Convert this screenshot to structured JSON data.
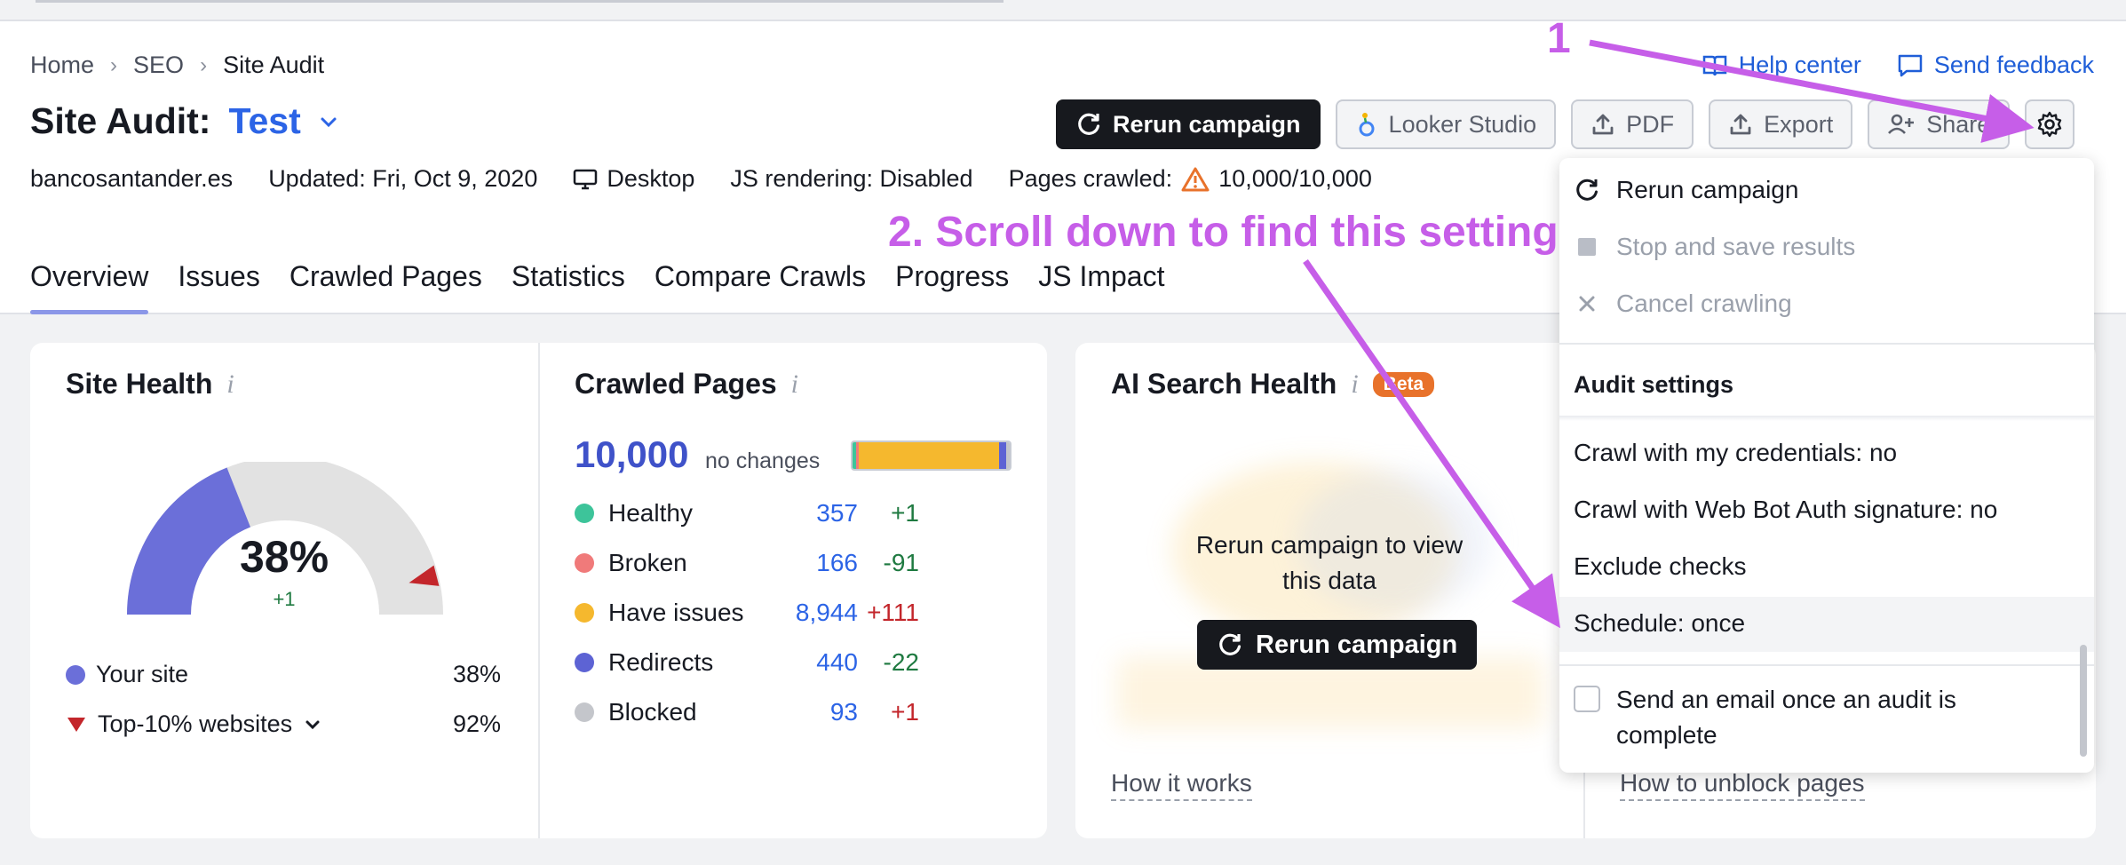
{
  "breadcrumb": [
    "Home",
    "SEO",
    "Site Audit"
  ],
  "title": {
    "label": "Site Audit:",
    "project": "Test"
  },
  "meta": {
    "domain": "bancosantander.es",
    "updated": "Updated: Fri, Oct 9, 2020",
    "device": "Desktop",
    "js_rendering": "JS rendering: Disabled",
    "pages_crawled_label": "Pages crawled:",
    "pages_crawled_value": "10,000/10,000"
  },
  "top_links": {
    "help": "Help center",
    "feedback": "Send feedback"
  },
  "toolbar": {
    "rerun": "Rerun campaign",
    "looker": "Looker Studio",
    "pdf": "PDF",
    "export": "Export",
    "share": "Share"
  },
  "tabs": [
    "Overview",
    "Issues",
    "Crawled Pages",
    "Statistics",
    "Compare Crawls",
    "Progress",
    "JS Impact"
  ],
  "site_health": {
    "title": "Site Health",
    "percent": "38%",
    "delta": "+1",
    "value_fraction": 0.38,
    "top10_fraction": 0.92,
    "legend": [
      {
        "label": "Your site",
        "value": "38%"
      },
      {
        "label": "Top-10% websites",
        "value": "92%"
      }
    ]
  },
  "crawled_pages": {
    "title": "Crawled Pages",
    "total": "10,000",
    "total_note": "no changes",
    "rows": [
      {
        "label": "Healthy",
        "value": "357",
        "delta": "+1",
        "color": "#3dc49a",
        "delta_color": "#1f7a41"
      },
      {
        "label": "Broken",
        "value": "166",
        "delta": "-91",
        "color": "#f07a7a",
        "delta_color": "#1f7a41"
      },
      {
        "label": "Have issues",
        "value": "8,944",
        "delta": "+111",
        "color": "#f5b82e",
        "delta_color": "#c3262b"
      },
      {
        "label": "Redirects",
        "value": "440",
        "delta": "-22",
        "color": "#5d63d4",
        "delta_color": "#1f7a41"
      },
      {
        "label": "Blocked",
        "value": "93",
        "delta": "+1",
        "color": "#c4c6cb",
        "delta_color": "#c3262b"
      }
    ]
  },
  "ai_search": {
    "title": "AI Search Health",
    "badge": "Beta",
    "message": "Rerun campaign to view this data",
    "button": "Rerun campaign",
    "link1": "How it works",
    "link2": "How to unblock pages"
  },
  "menu": {
    "actions": [
      {
        "label": "Rerun campaign",
        "disabled": false
      },
      {
        "label": "Stop and save results",
        "disabled": true
      },
      {
        "label": "Cancel crawling",
        "disabled": true
      }
    ],
    "section": "Audit settings",
    "settings": [
      "Crawl with my credentials: no",
      "Crawl with Web Bot Auth signature: no",
      "Exclude checks",
      "Schedule: once"
    ],
    "email_checkbox": "Send an email once an audit is complete"
  },
  "annotations": {
    "step1": "1",
    "step2": "2. Scroll down to find this setting"
  },
  "colors": {
    "accent": "#2c64e6",
    "annotation": "#c65ee8",
    "gauge_site": "#6b6fd9",
    "gauge_bg": "#e2e2e2",
    "top10_marker": "#c3262b"
  }
}
